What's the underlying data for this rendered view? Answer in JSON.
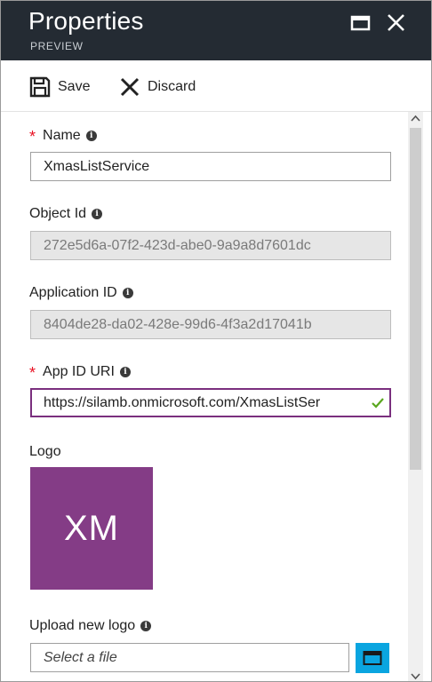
{
  "window": {
    "title": "Properties",
    "subtitle": "PREVIEW"
  },
  "toolbar": {
    "save_label": "Save",
    "discard_label": "Discard"
  },
  "form": {
    "name": {
      "label": "Name",
      "value": "XmasListService",
      "required": true
    },
    "object_id": {
      "label": "Object Id",
      "value": "272e5d6a-07f2-423d-abe0-9a9a8d7601dc"
    },
    "application_id": {
      "label": "Application ID",
      "value": "8404de28-da02-428e-99d6-4f3a2d17041b"
    },
    "app_id_uri": {
      "label": "App ID URI",
      "value": "https://silamb.onmicrosoft.com/XmasListSer",
      "required": true
    },
    "logo": {
      "label": "Logo",
      "initials": "XM"
    },
    "upload_logo": {
      "label": "Upload new logo",
      "placeholder": "Select a file"
    }
  },
  "colors": {
    "header_bg": "#242b33",
    "required_star": "#e81123",
    "logo_bg": "#843c86",
    "focus_border": "#7a2f7e",
    "check_mark": "#5aa71e",
    "file_button": "#0aa5e0"
  },
  "icons": {
    "info": "i"
  }
}
